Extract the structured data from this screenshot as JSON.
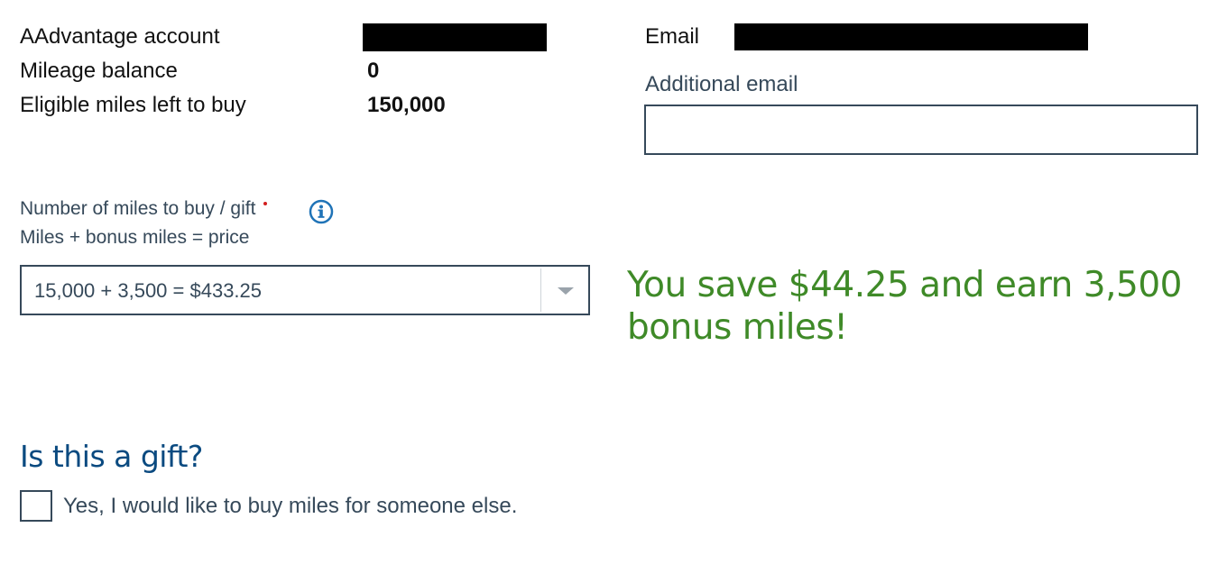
{
  "account": {
    "rows": [
      {
        "label": "AAdvantage account",
        "value": ""
      },
      {
        "label": "Mileage balance",
        "value": "0"
      },
      {
        "label": "Eligible miles left to buy",
        "value": "150,000"
      }
    ]
  },
  "contact": {
    "email_label": "Email",
    "email_value": "",
    "additional_email_label": "Additional email",
    "additional_email_value": "",
    "additional_email_placeholder": ""
  },
  "purchase": {
    "miles_label": "Number of miles to buy / gift",
    "formula_label": "Miles + bonus miles = price",
    "selected_option": "15,000 + 3,500 = $433.25",
    "savings_message": "You save $44.25 and earn 3,500 bonus miles!"
  },
  "gift": {
    "heading": "Is this a gift?",
    "checkbox_label": "Yes, I would like to buy miles for someone else.",
    "checked": false
  },
  "icons": {
    "info": "info-icon",
    "dropdown": "chevron-down-icon"
  },
  "colors": {
    "text_dark": "#111111",
    "label_slate": "#36495a",
    "heading_blue": "#0a4a80",
    "savings_green": "#3f8a28",
    "info_blue": "#1f73b7",
    "required_red": "#d21e1e",
    "redaction": "#000000"
  }
}
